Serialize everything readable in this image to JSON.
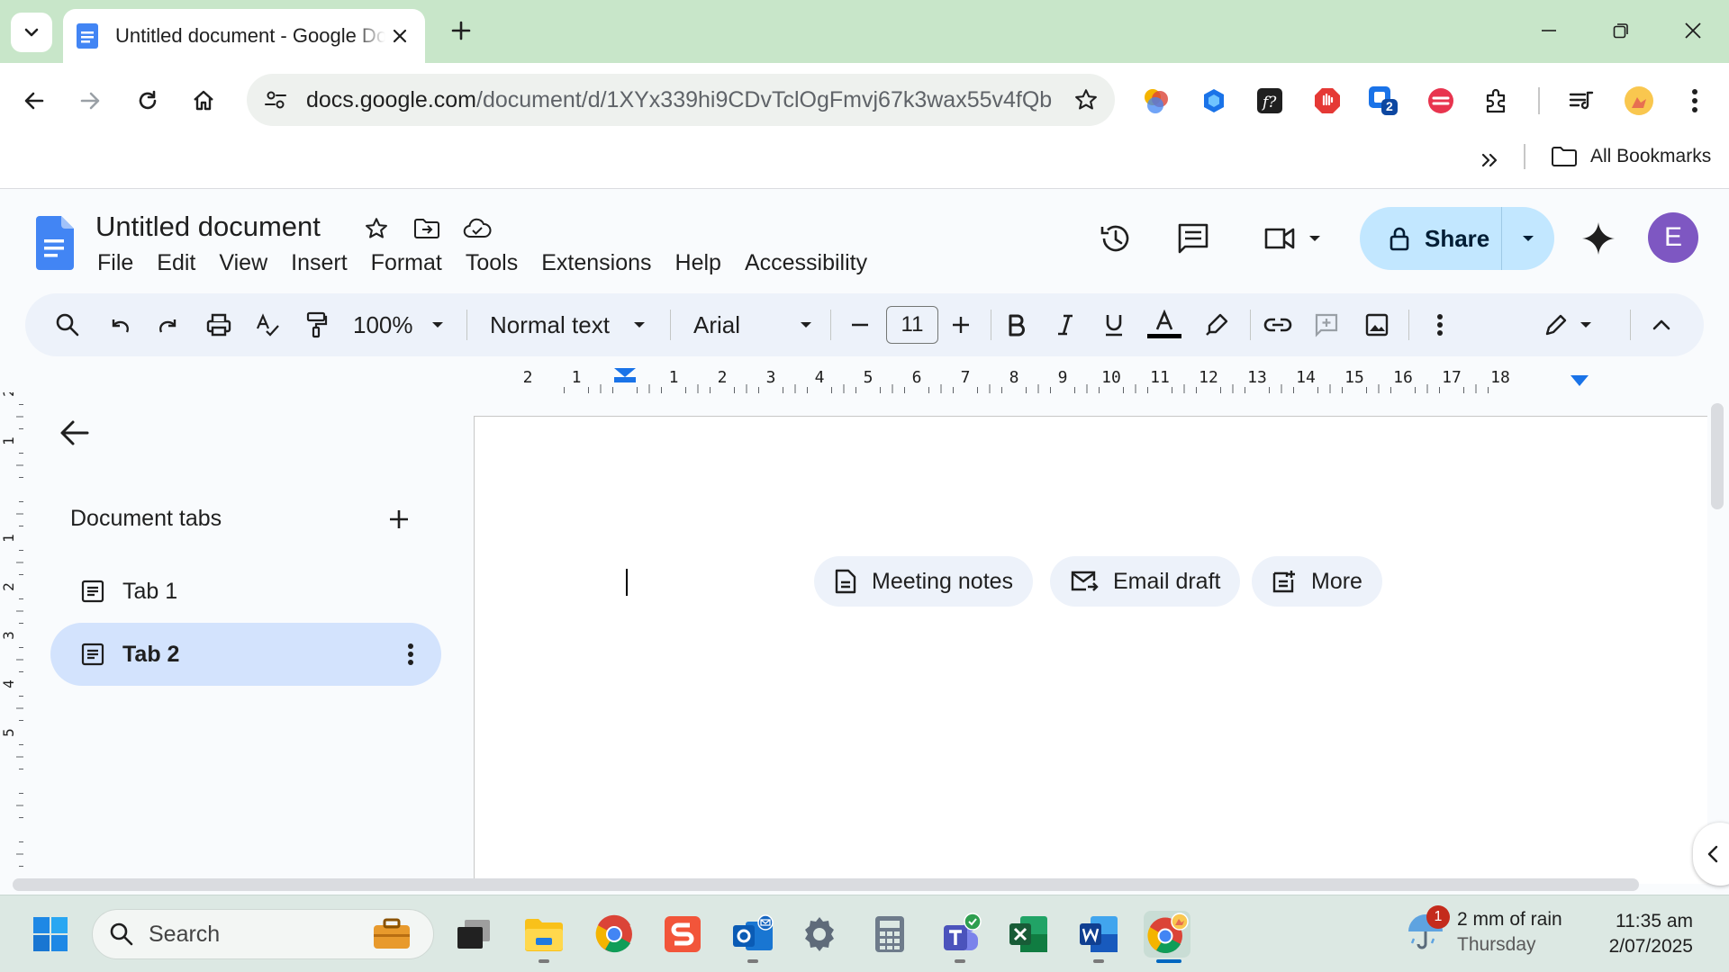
{
  "browser": {
    "tab_title": "Untitled document - Google Docs",
    "url_host": "docs.google.com",
    "url_path": "/document/d/1XYx339hi9CDvTclOgFmvj67k3wax55v4fQb...",
    "bookmarks_label": "All Bookmarks",
    "extension_badge": "2"
  },
  "docs": {
    "title": "Untitled document",
    "menu": [
      "File",
      "Edit",
      "View",
      "Insert",
      "Format",
      "Tools",
      "Extensions",
      "Help",
      "Accessibility"
    ],
    "share_label": "Share",
    "avatar_letter": "E"
  },
  "toolbar": {
    "zoom": "100%",
    "style": "Normal text",
    "font": "Arial",
    "font_size": "11"
  },
  "ruler": {
    "h_labels": [
      "2",
      "1",
      "1",
      "2",
      "3",
      "4",
      "5",
      "6",
      "7",
      "8",
      "9",
      "10",
      "11",
      "12",
      "13",
      "14",
      "15",
      "16",
      "17",
      "18"
    ],
    "v_labels": [
      "2",
      "1",
      "1",
      "2",
      "3",
      "4",
      "5"
    ]
  },
  "side_panel": {
    "title": "Document tabs",
    "tabs": [
      {
        "label": "Tab 1",
        "selected": false
      },
      {
        "label": "Tab 2",
        "selected": true
      }
    ]
  },
  "page": {
    "chips": [
      "Meeting notes",
      "Email draft",
      "More"
    ]
  },
  "taskbar": {
    "search_label": "Search",
    "weather_main": "2 mm of rain",
    "weather_sub": "Thursday",
    "weather_badge": "1",
    "time": "11:35 am",
    "date": "2/07/2025"
  },
  "colors": {
    "tab_strip": "#c8e6c9",
    "share_button": "#c2e7ff",
    "selected_tab": "#d3e3fd",
    "toolbar_bg": "#edf2fa",
    "avatar": "#7e57c2"
  }
}
